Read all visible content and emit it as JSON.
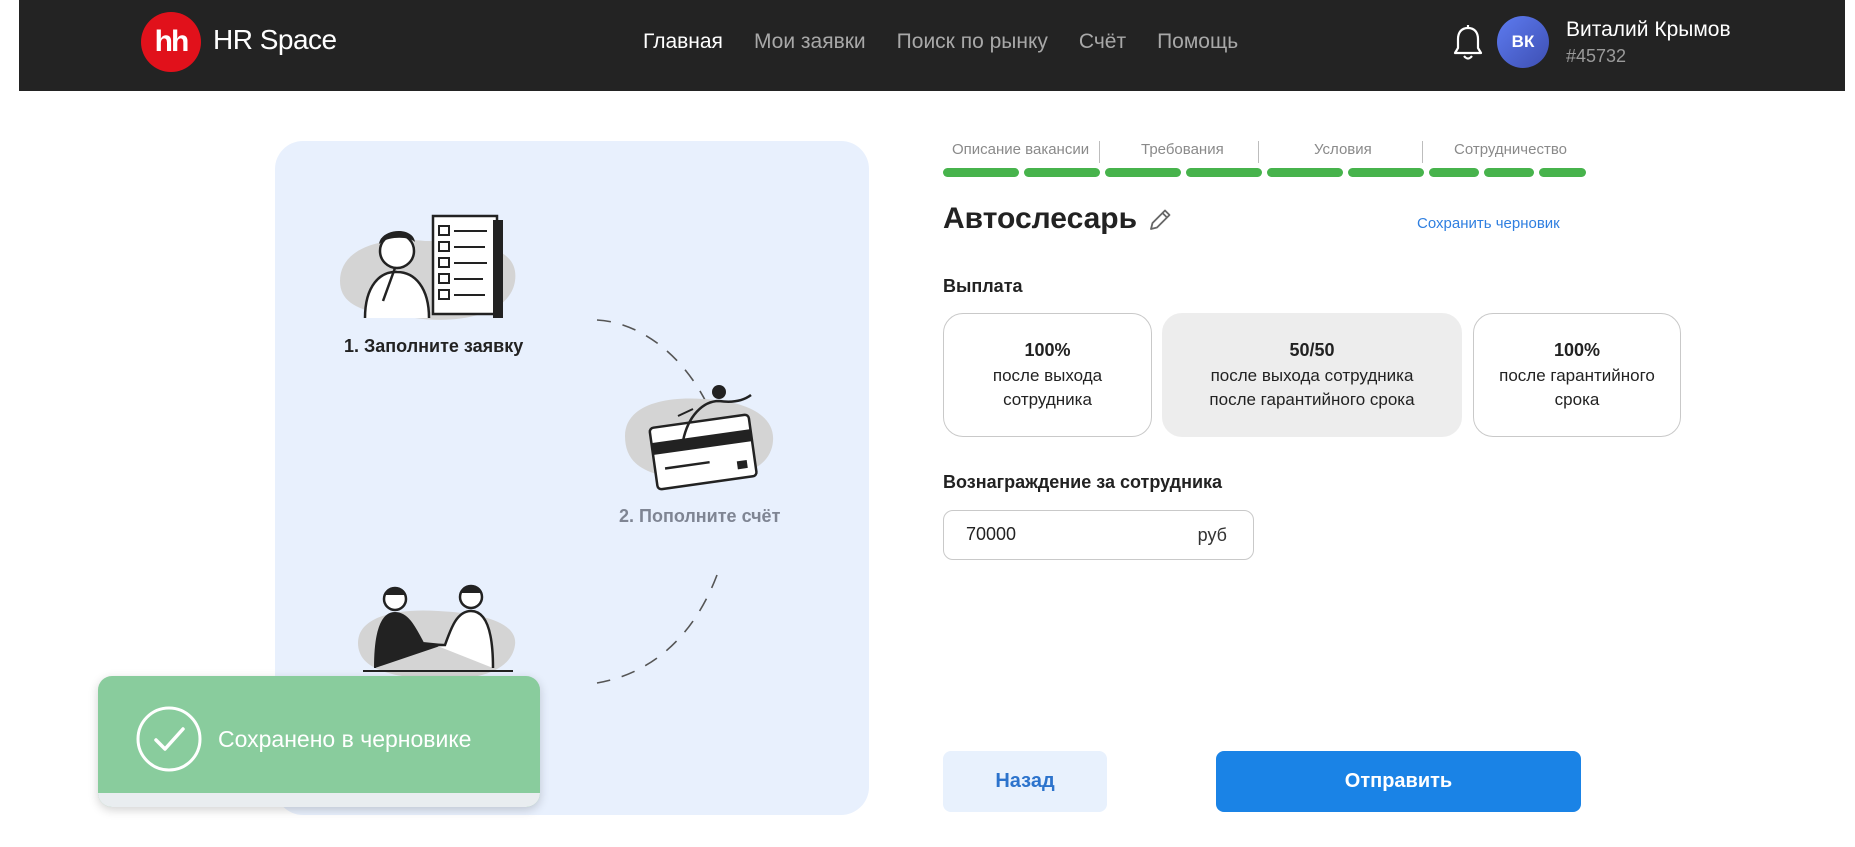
{
  "header": {
    "logo_text": "hh",
    "brand": "HR Space",
    "nav": [
      "Главная",
      "Мои заявки",
      "Поиск по рынку",
      "Счёт",
      "Помощь"
    ],
    "active_nav": "Главная",
    "user": {
      "initials": "ВК",
      "name": "Виталий Крымов",
      "id": "#45732"
    }
  },
  "illustration": {
    "step1": "1. Заполните заявку",
    "step2": "2. Пополните счёт"
  },
  "form": {
    "steps": [
      "Описание вакансии",
      "Требования",
      "Условия",
      "Сотрудничество"
    ],
    "progress_segments_filled": 9,
    "title": "Автослесарь",
    "save_draft": "Сохранить черновик",
    "payment_label": "Выплата",
    "payment_options": [
      {
        "pct": "100%",
        "l1": "после выхода",
        "l2": "сотрудника"
      },
      {
        "pct": "50/50",
        "l1": "после выхода сотрудника",
        "l2": "после гарантийного срока"
      },
      {
        "pct": "100%",
        "l1": "после гарантийного",
        "l2": "срока"
      }
    ],
    "selected_payment": "50/50",
    "reward_label": "Вознаграждение за сотрудника",
    "reward_value": "70000",
    "reward_unit": "руб",
    "back_button": "Назад",
    "send_button": "Отправить"
  },
  "toast": {
    "message": "Сохранено в черновике"
  },
  "colors": {
    "header_bg": "#232323",
    "brand_red": "#e1111b",
    "progress_green": "#47b34c",
    "primary_blue": "#1a83e6",
    "panel_bg": "#e8f0fd",
    "toast_green": "#89cc9d"
  },
  "icons": [
    "bell-icon",
    "pencil-icon",
    "checkmark-icon"
  ]
}
